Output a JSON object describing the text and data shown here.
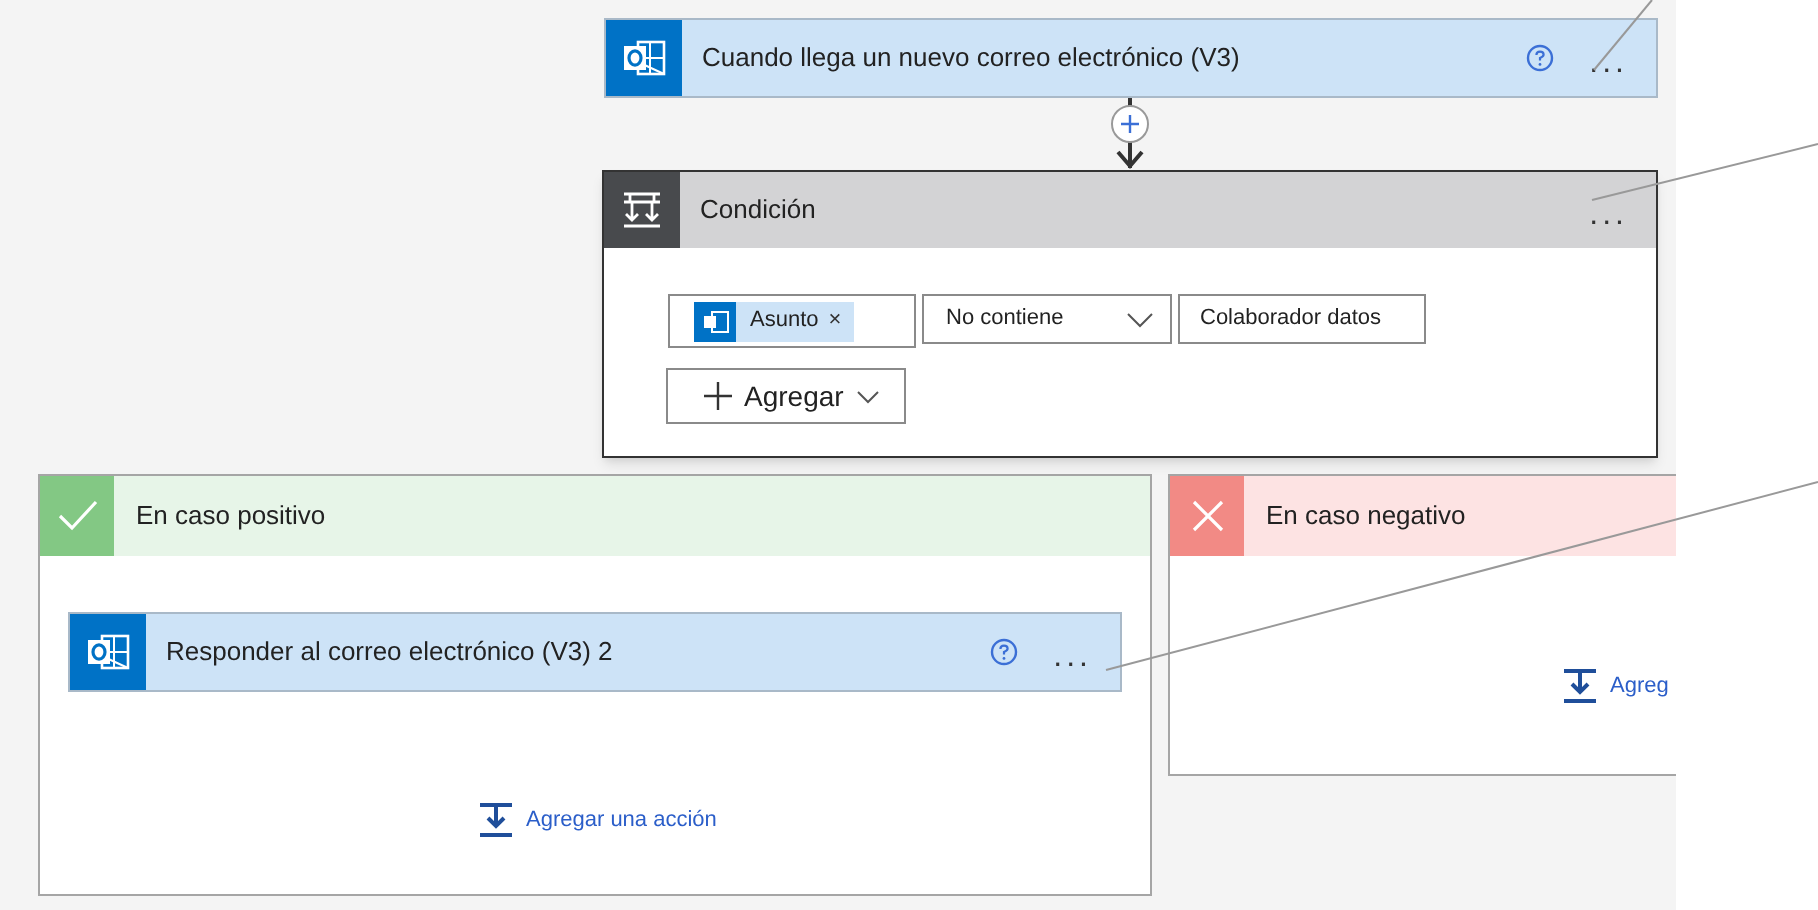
{
  "trigger": {
    "title": "Cuando llega un nuevo correo electrónico (V3)",
    "menu": "..."
  },
  "condition": {
    "title": "Condición",
    "menu": "...",
    "token": "Asunto",
    "token_remove": "×",
    "operator": "No contiene",
    "value": "Colaborador datos",
    "add_button": "Agregar"
  },
  "branches": [
    {
      "kind": "yes",
      "title": "En caso positivo",
      "action": {
        "title": "Responder al correo electrónico (V3) 2",
        "menu": "..."
      },
      "add_action": "Agregar una acción"
    },
    {
      "kind": "no",
      "title": "En caso negativo",
      "add_action": "Agreg"
    }
  ]
}
